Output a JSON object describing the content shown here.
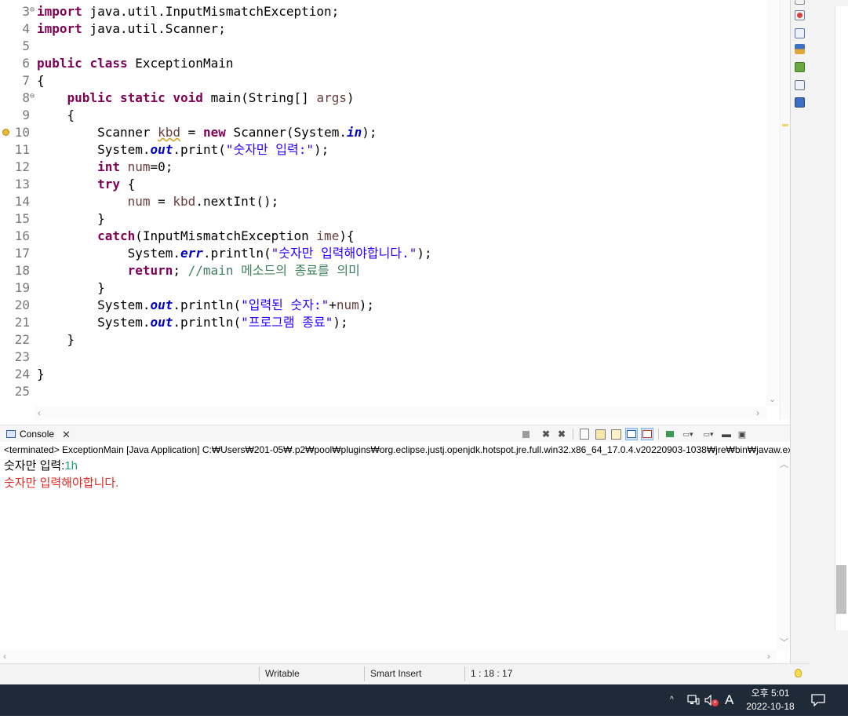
{
  "editor": {
    "lines": [
      {
        "n": "3",
        "fold": "⊖"
      },
      {
        "n": "4"
      },
      {
        "n": "5"
      },
      {
        "n": "6"
      },
      {
        "n": "7"
      },
      {
        "n": "8",
        "fold": "⊖"
      },
      {
        "n": "9"
      },
      {
        "n": "10",
        "warning": true
      },
      {
        "n": "11"
      },
      {
        "n": "12"
      },
      {
        "n": "13"
      },
      {
        "n": "14"
      },
      {
        "n": "15"
      },
      {
        "n": "16"
      },
      {
        "n": "17"
      },
      {
        "n": "18"
      },
      {
        "n": "19"
      },
      {
        "n": "20"
      },
      {
        "n": "21"
      },
      {
        "n": "22"
      },
      {
        "n": "23"
      },
      {
        "n": "24"
      },
      {
        "n": "25"
      }
    ],
    "code": [
      [
        {
          "t": "import",
          "c": "kw"
        },
        {
          "t": " java.util.InputMismatchException;"
        }
      ],
      [
        {
          "t": "import",
          "c": "kw"
        },
        {
          "t": " java.util.Scanner;"
        }
      ],
      [],
      [
        {
          "t": "public",
          "c": "kw"
        },
        {
          "t": " "
        },
        {
          "t": "class",
          "c": "kw"
        },
        {
          "t": " ExceptionMain"
        }
      ],
      [
        {
          "t": "{"
        }
      ],
      [
        {
          "t": "    "
        },
        {
          "t": "public",
          "c": "kw"
        },
        {
          "t": " "
        },
        {
          "t": "static",
          "c": "kw"
        },
        {
          "t": " "
        },
        {
          "t": "void",
          "c": "kw"
        },
        {
          "t": " main(String[] "
        },
        {
          "t": "args",
          "c": "var"
        },
        {
          "t": ")"
        }
      ],
      [
        {
          "t": "    {"
        }
      ],
      [
        {
          "t": "        Scanner "
        },
        {
          "t": "kbd",
          "c": "var wavy"
        },
        {
          "t": " = "
        },
        {
          "t": "new",
          "c": "kw"
        },
        {
          "t": " Scanner(System."
        },
        {
          "t": "in",
          "c": "fld"
        },
        {
          "t": ");"
        }
      ],
      [
        {
          "t": "        System."
        },
        {
          "t": "out",
          "c": "fld"
        },
        {
          "t": ".print("
        },
        {
          "t": "\"숫자만 입력:\"",
          "c": "str"
        },
        {
          "t": ");"
        }
      ],
      [
        {
          "t": "        "
        },
        {
          "t": "int",
          "c": "kw"
        },
        {
          "t": " "
        },
        {
          "t": "num",
          "c": "var"
        },
        {
          "t": "=0;"
        }
      ],
      [
        {
          "t": "        "
        },
        {
          "t": "try",
          "c": "kw"
        },
        {
          "t": " {"
        }
      ],
      [
        {
          "t": "            "
        },
        {
          "t": "num",
          "c": "var"
        },
        {
          "t": " = "
        },
        {
          "t": "kbd",
          "c": "var"
        },
        {
          "t": ".nextInt();"
        }
      ],
      [
        {
          "t": "        }"
        }
      ],
      [
        {
          "t": "        "
        },
        {
          "t": "catch",
          "c": "kw"
        },
        {
          "t": "(InputMismatchException "
        },
        {
          "t": "ime",
          "c": "var"
        },
        {
          "t": "){"
        }
      ],
      [
        {
          "t": "            System."
        },
        {
          "t": "err",
          "c": "fld"
        },
        {
          "t": ".println("
        },
        {
          "t": "\"숫자만 입력해야합니다.\"",
          "c": "str"
        },
        {
          "t": ");"
        }
      ],
      [
        {
          "t": "            "
        },
        {
          "t": "return",
          "c": "kw"
        },
        {
          "t": "; "
        },
        {
          "t": "//main 메소드의 종료를 의미",
          "c": "cmt"
        }
      ],
      [
        {
          "t": "        }"
        }
      ],
      [
        {
          "t": "        System."
        },
        {
          "t": "out",
          "c": "fld"
        },
        {
          "t": ".println("
        },
        {
          "t": "\"입력된 숫자:\"",
          "c": "str"
        },
        {
          "t": "+"
        },
        {
          "t": "num",
          "c": "var"
        },
        {
          "t": ");"
        }
      ],
      [
        {
          "t": "        System."
        },
        {
          "t": "out",
          "c": "fld"
        },
        {
          "t": ".println("
        },
        {
          "t": "\"프로그램 종료\"",
          "c": "str"
        },
        {
          "t": ");"
        }
      ],
      [
        {
          "t": "    }"
        }
      ],
      [],
      [
        {
          "t": "}"
        }
      ],
      []
    ]
  },
  "console": {
    "tab_label": "Console",
    "close_glyph": "✕",
    "status_line": "<terminated> ExceptionMain [Java Application] C:₩Users₩201-05₩.p2₩pool₩plugins₩org.eclipse.justj.openjdk.hotspot.jre.full.win32.x86_64_17.0.4.v20220903-1038₩jre₩bin₩javaw.exe",
    "output_prompt": "숫자만 입력:",
    "output_input": "1h",
    "output_error": "숫자만 입력해야합니다.",
    "toolbar_icons": [
      "terminate-icon",
      "remove-launch-icon",
      "remove-all-icon",
      "clear-console-icon",
      "scroll-lock-icon",
      "word-wrap-icon",
      "show-stdout-icon",
      "show-stderr-icon",
      "pin-console-icon",
      "display-console-icon",
      "open-console-icon",
      "minimize-icon",
      "maximize-icon"
    ]
  },
  "statusbar": {
    "writable": "Writable",
    "insert_mode": "Smart Insert",
    "position": "1 : 18 : 17"
  },
  "taskbar": {
    "tray_chevron": "^",
    "ime_indicator": "A",
    "time": "오후 5:01",
    "date": "2022-10-18"
  }
}
